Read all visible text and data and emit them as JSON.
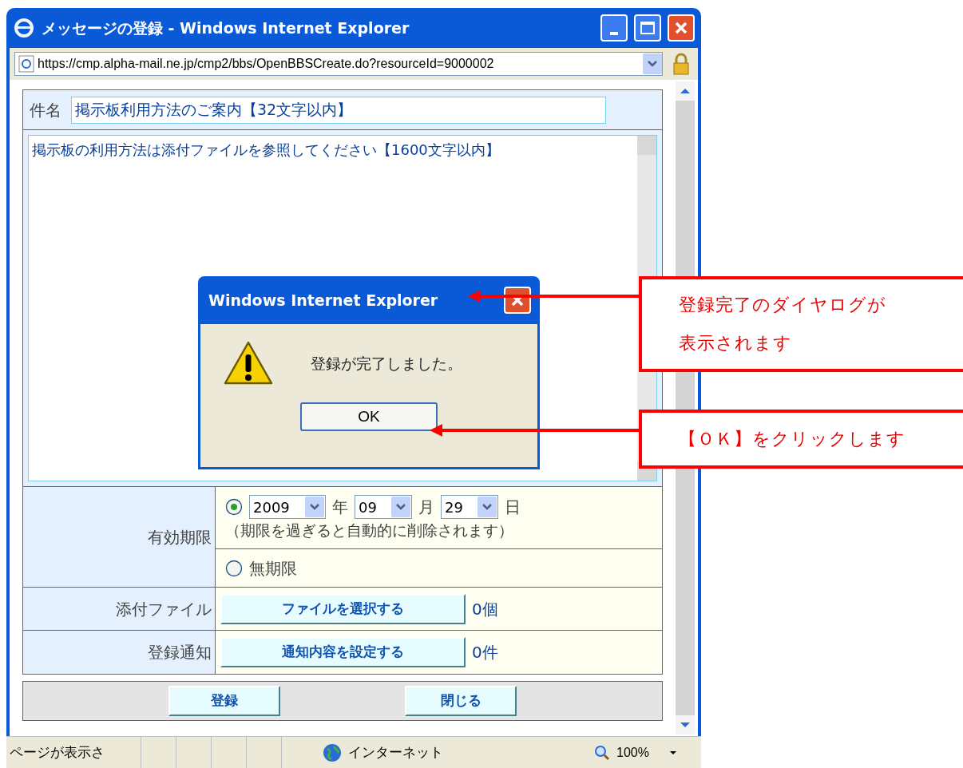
{
  "window": {
    "title": "メッセージの登録 - Windows Internet Explorer",
    "address": "https://cmp.alpha-mail.ne.jp/cmp2/bbs/OpenBBSCreate.do?resourceId=9000002"
  },
  "form": {
    "subject": {
      "label": "件名",
      "value": "掲示板利用方法のご案内【32文字以内】"
    },
    "body": {
      "value": "掲示板の利用方法は添付ファイルを参照してください【1600文字以内】"
    },
    "expiry": {
      "label": "有効期限",
      "options": [
        {
          "kind": "date",
          "selected": true,
          "year": "2009",
          "year_unit": "年",
          "month": "09",
          "month_unit": "月",
          "day": "29",
          "day_unit": "日",
          "note": "（期限を過ぎると自動的に削除されます）"
        },
        {
          "kind": "plain",
          "selected": false,
          "label": "無期限"
        }
      ]
    },
    "attachment": {
      "label": "添付ファイル",
      "button": "ファイルを選択する",
      "count": "0個"
    },
    "notification": {
      "label": "登録通知",
      "button": "通知内容を設定する",
      "count": "0件"
    },
    "buttons": [
      "登録",
      "閉じる"
    ]
  },
  "status_bar": {
    "text": "ページが表示さ",
    "zone": "インターネット",
    "zoom": "100%"
  },
  "dialog": {
    "title": "Windows Internet Explorer",
    "message": "登録が完了しました。",
    "button": "OK"
  },
  "callouts": [
    {
      "lines": [
        "登録完了のダイヤログが",
        "表示されます"
      ]
    },
    {
      "lines": [
        "【ＯＫ】をクリックします"
      ]
    }
  ]
}
